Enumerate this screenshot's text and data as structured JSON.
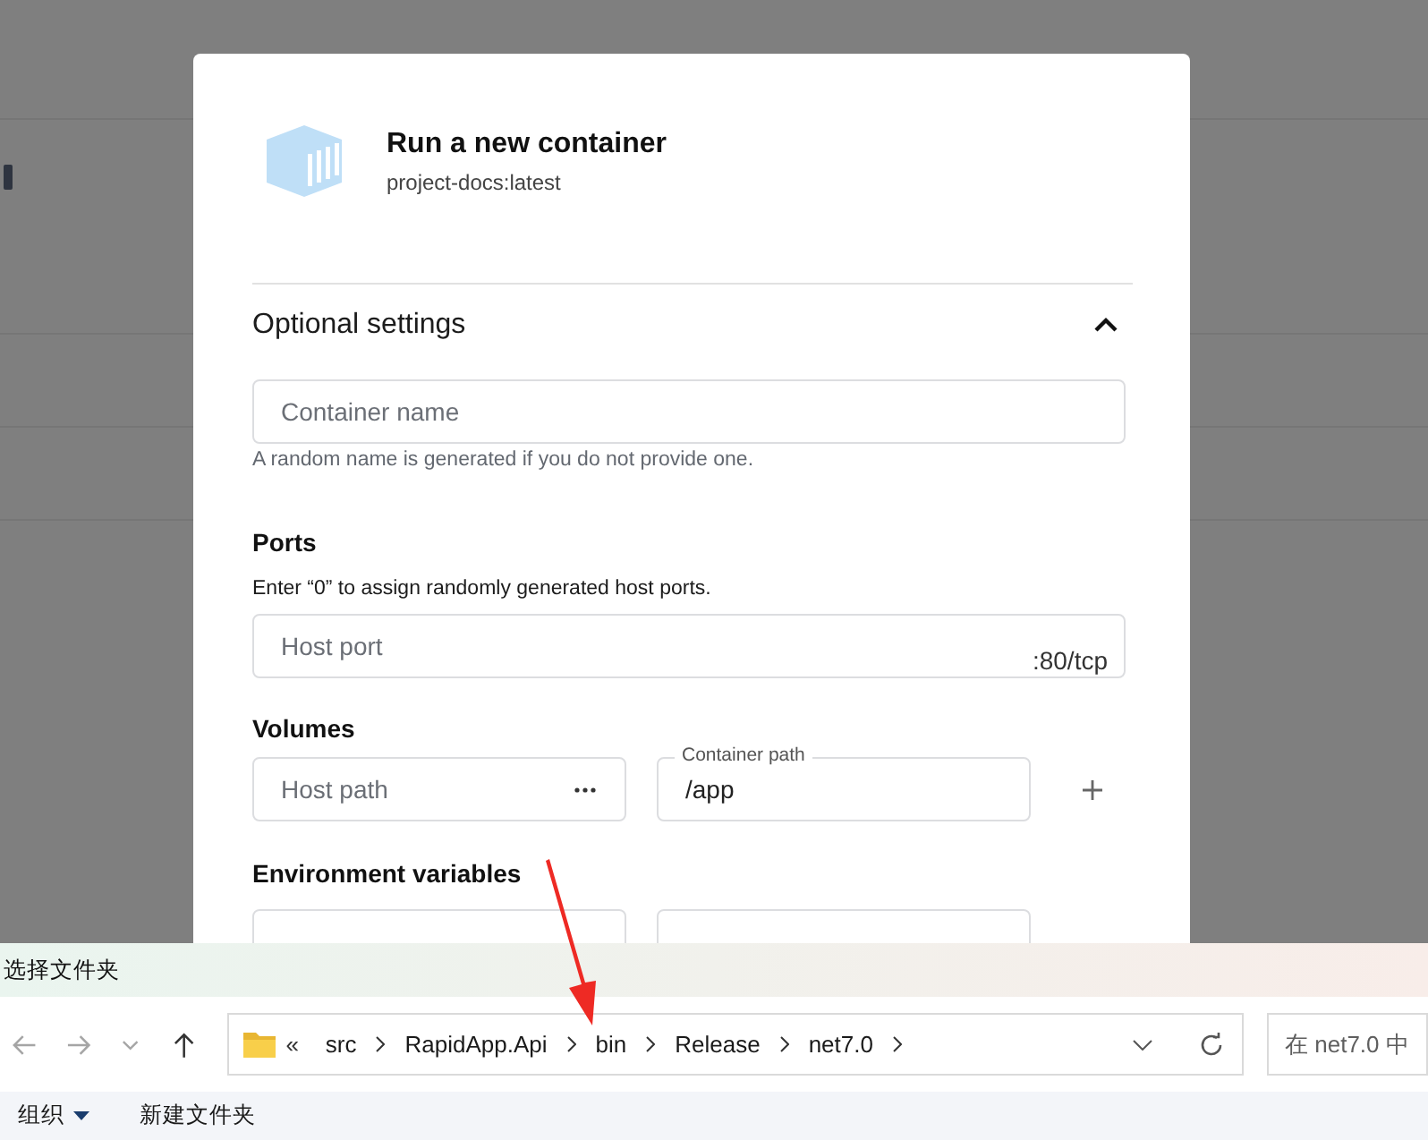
{
  "modal": {
    "title": "Run a new container",
    "image": "project-docs:latest",
    "section": {
      "title": "Optional settings",
      "expanded": true
    },
    "container_name": {
      "placeholder": "Container name",
      "helper": "A random name is generated if you do not provide one."
    },
    "ports": {
      "title": "Ports",
      "description": "Enter “0” to assign randomly generated host ports.",
      "host_port": {
        "placeholder": "Host port"
      },
      "container_port": ":80/tcp"
    },
    "volumes": {
      "title": "Volumes",
      "host_path": {
        "placeholder": "Host path"
      },
      "container_path": {
        "label": "Container path",
        "value": "/app"
      }
    },
    "environment": {
      "title": "Environment variables"
    }
  },
  "file_dialog": {
    "title": "选择文件夹",
    "nav": [
      {
        "kind": "back",
        "disabled": true
      },
      {
        "kind": "forward",
        "disabled": true
      },
      {
        "kind": "recent",
        "disabled": true
      },
      {
        "kind": "up",
        "disabled": false
      }
    ],
    "overflow": "«",
    "path": [
      "src",
      "RapidApp.Api",
      "bin",
      "Release",
      "net7.0"
    ],
    "search": {
      "placeholder": "在 net7.0 中"
    },
    "toolbar": [
      {
        "label": "组织",
        "dropdown": true
      },
      {
        "label": "新建文件夹",
        "dropdown": false
      }
    ]
  }
}
